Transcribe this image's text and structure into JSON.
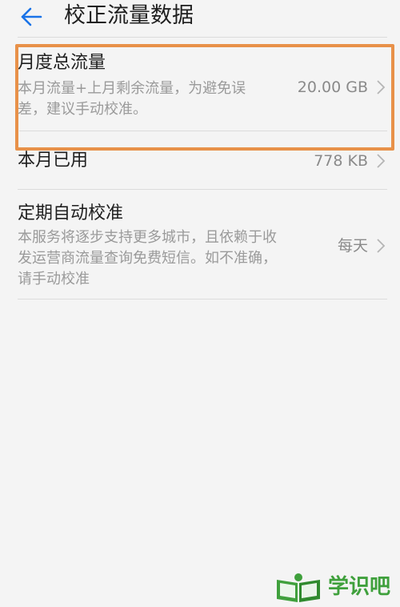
{
  "header": {
    "title": "校正流量数据",
    "back_icon": "arrow-left-icon",
    "accent": "#1a73e8"
  },
  "items": [
    {
      "title": "月度总流量",
      "subtitle_line1": "本月流量+上月剩余流量，为避免误",
      "subtitle_line2": "差，建议手动校准。",
      "value": "20.00 GB",
      "highlighted": true,
      "highlight_color": "#e89149"
    },
    {
      "title": "本月已用",
      "value": "778 KB"
    },
    {
      "title": "定期自动校准",
      "subtitle_line1": "本服务将逐步支持更多城市，且依赖于收",
      "subtitle_line2": "发运营商流量查询免费短信。如不准确，",
      "subtitle_line3": "请手动校准",
      "value": "每天"
    }
  ],
  "watermark": {
    "text": "学识吧",
    "icon": "book-logo-icon",
    "color": "#3fa03c"
  }
}
